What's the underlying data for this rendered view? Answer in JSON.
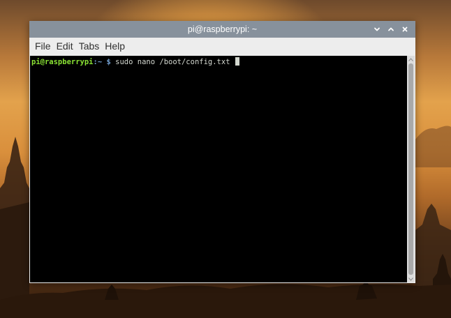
{
  "window": {
    "title": "pi@raspberrypi: ~",
    "controls": {
      "minimize_icon": "chevron-down-icon",
      "maximize_icon": "chevron-up-icon",
      "close_icon": "close-icon"
    }
  },
  "menubar": {
    "items": [
      {
        "label": "File"
      },
      {
        "label": "Edit"
      },
      {
        "label": "Tabs"
      },
      {
        "label": "Help"
      }
    ]
  },
  "terminal": {
    "prompt_user_host": "pi@raspberrypi",
    "prompt_separator": ":",
    "prompt_path": "~",
    "prompt_symbol": "$",
    "command": "sudo nano /boot/config.txt",
    "colors": {
      "background": "#000000",
      "user_host": "#8ae234",
      "path": "#729fcf",
      "text": "#d3d7cf"
    }
  },
  "colors": {
    "titlebar": "#87919c",
    "menubar": "#ededed"
  }
}
